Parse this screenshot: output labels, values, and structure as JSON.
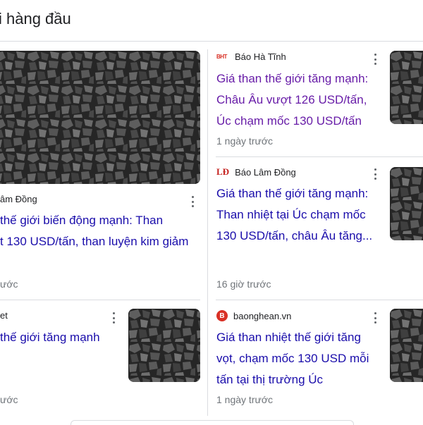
{
  "section": {
    "title": "i hàng đầu"
  },
  "colors": {
    "link": "#1a0dab",
    "visited_link": "#681da8",
    "meta": "#70757a",
    "divider": "#dadce0"
  },
  "cards": [
    {
      "source": "âm Đồng",
      "headline": "thế giới biến động mạnh: Than\nt 130 USD/tấn, than luyện kim giảm",
      "time": "ước",
      "image": "coal-image",
      "menu_icon": "more-vert-icon"
    },
    {
      "source": "et",
      "headline": "thế giới tăng mạnh",
      "time": "ước",
      "image": "coal-image",
      "menu_icon": "more-vert-icon"
    },
    {
      "source": "Báo Hà Tĩnh",
      "logo": "BHT",
      "headline": "Giá than thế giới tăng mạnh: Châu Âu vượt 126 USD/tấn, Úc chạm mốc 130 USD/tấn",
      "time": "1 ngày trước",
      "image": "coal-image",
      "menu_icon": "more-vert-icon"
    },
    {
      "source": "Báo Lâm Đồng",
      "logo": "LĐ",
      "headline": "Giá than thế giới tăng mạnh: Than nhiệt tại Úc chạm mốc 130 USD/tấn, châu Âu tăng...",
      "time": "16 giờ trước",
      "image": "coal-image",
      "menu_icon": "more-vert-icon"
    },
    {
      "source": "baonghean.vn",
      "logo": "B",
      "headline": "Giá than nhiệt thế giới tăng vọt, chạm mốc 130 USD mỗi tấn tại thị trường Úc",
      "time": "1 ngày trước",
      "image": "coal-image",
      "menu_icon": "more-vert-icon"
    }
  ]
}
